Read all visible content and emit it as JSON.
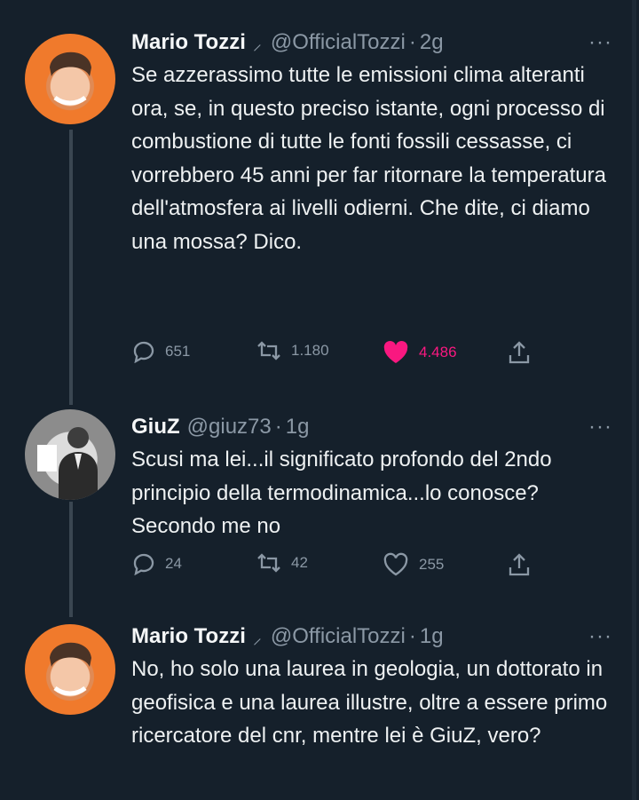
{
  "tweets": [
    {
      "name": "Mario Tozzi",
      "badge": "⸝",
      "handle": "@OfficialTozzi",
      "time": "2g",
      "text": "Se azzerassimo tutte le emissioni clima alteranti ora, se, in questo preciso istante, ogni processo di combustione di tutte le fonti fossili cessasse, ci vorrebbero 45 anni per far ritornare la temperatura dell'atmosfera ai livelli odierni. Che dite,  ci diamo una mossa? Dico.",
      "replies": "651",
      "retweets": "1.180",
      "likes": "4.486",
      "liked": true
    },
    {
      "name": "GiuZ",
      "handle": "@giuz73",
      "time": "1g",
      "text": "Scusi ma lei...il significato profondo del 2ndo principio della termodinamica...lo conosce? Secondo me no",
      "replies": "24",
      "retweets": "42",
      "likes": "255",
      "liked": false
    },
    {
      "name": "Mario Tozzi",
      "badge": "⸝",
      "handle": "@OfficialTozzi",
      "time": "1g",
      "text": "No, ho solo una laurea in geologia, un dottorato in geofisica e una laurea illustre, oltre a essere primo ricercatore del cnr, mentre lei è GiuZ, vero?"
    }
  ],
  "ui": {
    "separator": "·",
    "more": "···"
  },
  "colors": {
    "background": "#15202b",
    "secondary_text": "#8b98a5",
    "like_active": "#f91880"
  }
}
